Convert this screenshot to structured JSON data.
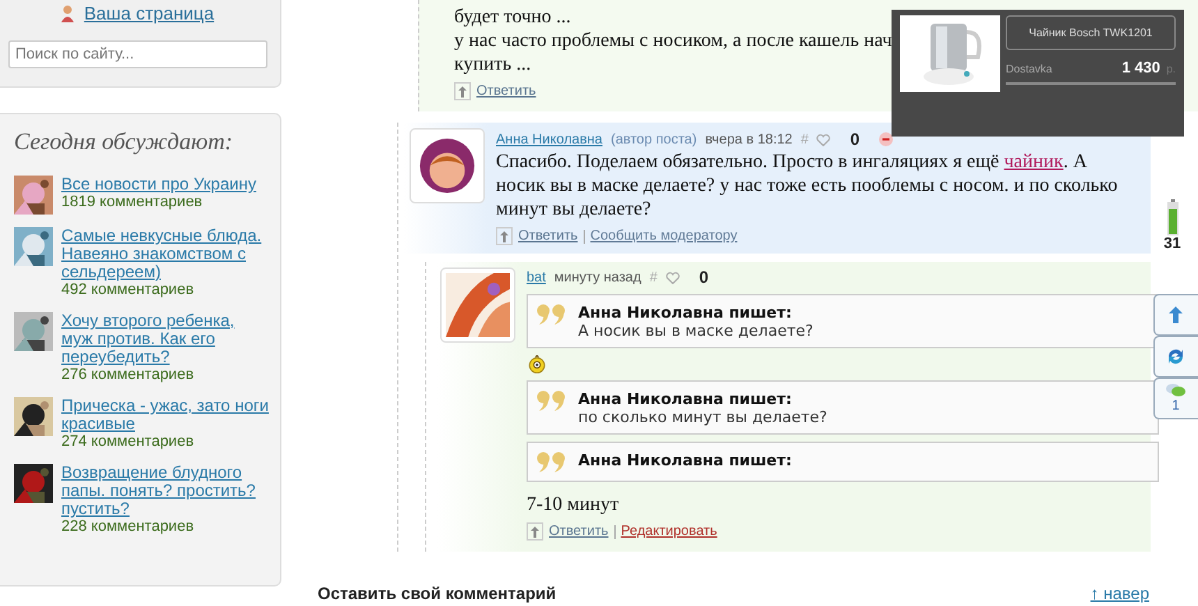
{
  "sidebar": {
    "profile_link": "Ваша страница",
    "search": {
      "placeholder": "Поиск по сайту..."
    },
    "discussed": {
      "title": "Сегодня обсуждают:",
      "items": [
        {
          "title": "Все новости про Украину",
          "count": "1819 комментариев"
        },
        {
          "title": "Самые невкусные блюда. Навеяно знакомством с сельдереем)",
          "count": "492 комментариев"
        },
        {
          "title": "Хочу второго ребенка, муж против. Как его переубедить?",
          "count": "276 комментариев"
        },
        {
          "title": "Прическа - ужас, зато ноги красивые",
          "count": "274 комментариев"
        },
        {
          "title": "Возвращение блудного папы. понять? простить? пустить?",
          "count": "228 комментариев"
        }
      ]
    }
  },
  "top_comment": {
    "lines": [
      "будет точно ...",
      "у нас часто проблемы с носиком, а после кашель нач",
      "купить ..."
    ],
    "actions": [
      {
        "label": "Ответить",
        "kind": "reply"
      }
    ]
  },
  "author_comment": {
    "author": "Анна Николавна",
    "role": "(автор поста)",
    "time": "вчера в 18:12",
    "hash": "#",
    "votes": "0",
    "text_before": "Спасибо. Поделаем обязательно. Просто в ингаляциях я ещё ",
    "link": "чайник",
    "text_after": ". А носик вы в маске делаете? у нас тоже есть пооблемы с носом. и по сколько минут вы делаете?",
    "actions": [
      {
        "label": "Ответить",
        "kind": "reply"
      },
      {
        "label": "Сообщить модератору",
        "kind": "report"
      }
    ]
  },
  "reply": {
    "author": "bat",
    "time": "минуту назад",
    "hash": "#",
    "votes": "0",
    "blocks": [
      {
        "kind": "quote",
        "who": "Анна Николавна пишет:",
        "text": "А носик вы в маске делаете?"
      },
      {
        "kind": "smiley"
      },
      {
        "kind": "quote",
        "who": "Анна Николавна пишет:",
        "text": "по сколько минут вы делаете?"
      },
      {
        "kind": "quote",
        "who": "Анна Николавна пишет:"
      },
      {
        "kind": "text",
        "text": "7-10 минут"
      }
    ],
    "actions": [
      {
        "label": "Ответить",
        "kind": "reply"
      },
      {
        "label": "Редактировать",
        "kind": "edit"
      }
    ]
  },
  "product_popup": {
    "name": "Чайник Bosch TWK1201",
    "shop": "Dostavka",
    "price": "1 430",
    "currency": "р."
  },
  "side_widgets": {
    "battery_reading": "31",
    "buttons": [
      {
        "kind": "up"
      },
      {
        "kind": "refresh"
      },
      {
        "kind": "comments",
        "count": "1"
      }
    ]
  },
  "footer": {
    "title": "Оставить свой комментарий",
    "top_link": "↑ навер"
  }
}
